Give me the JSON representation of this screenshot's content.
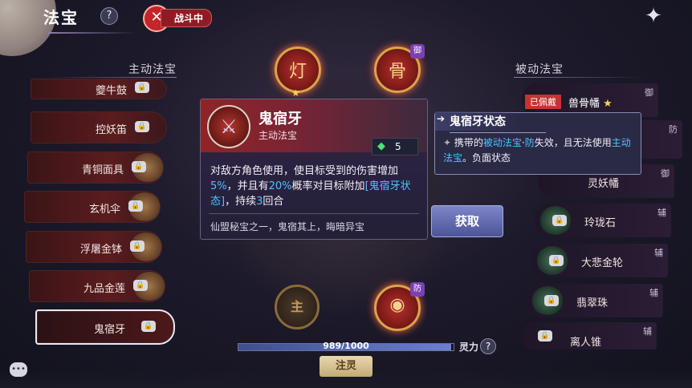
{
  "header": {
    "title": "法宝",
    "help_icon": "?",
    "battle_status": "战斗中",
    "battle_icon": "crossed-swords-icon",
    "close_icon": "shuriken-close-icon"
  },
  "left_panel": {
    "heading": "主动法宝",
    "items": [
      {
        "label": "夔牛鼓",
        "locked": true
      },
      {
        "label": "控妖笛",
        "locked": true
      },
      {
        "label": "青铜面具",
        "locked": true
      },
      {
        "label": "玄机伞",
        "locked": true
      },
      {
        "label": "浮屠金钵",
        "locked": true
      },
      {
        "label": "九品金莲",
        "locked": true
      },
      {
        "label": "鬼宿牙",
        "locked": true,
        "selected": true
      }
    ]
  },
  "right_panel": {
    "heading": "被动法宝",
    "equipped_badge": "已佩戴",
    "items": [
      {
        "label": "兽骨幡",
        "tag": "御",
        "equipped": true,
        "star": "★"
      },
      {
        "label": "",
        "tag": "防"
      },
      {
        "label": "灵妖幡",
        "tag": "御",
        "locked": true
      },
      {
        "label": "玲珑石",
        "tag": "辅",
        "locked": true
      },
      {
        "label": "大悲金轮",
        "tag": "辅",
        "locked": true
      },
      {
        "label": "翡翠珠",
        "tag": "辅",
        "locked": true
      },
      {
        "label": "离人锥",
        "tag": "辅",
        "locked": true
      }
    ]
  },
  "wheel": {
    "slots": [
      {
        "name": "lantern-slot",
        "icon": "lantern-icon",
        "glyph": "灯",
        "star": "★"
      },
      {
        "name": "skull-slot",
        "icon": "beast-skull-icon",
        "glyph": "骨",
        "badge": "御"
      },
      {
        "name": "eye-slot",
        "icon": "eye-pendant-icon",
        "glyph": "◉",
        "badge": "防"
      }
    ],
    "main_slot_label": "主"
  },
  "detail_card": {
    "name": "鬼宿牙",
    "type": "主动法宝",
    "icon": "fang-dagger-icon",
    "cost": "5",
    "desc_parts": [
      "对敌方角色使用，使目标受到的伤害增加",
      "5%",
      "，并且有",
      "20%",
      "概率对目标附加",
      "[鬼宿牙状态]",
      "，持续",
      "3",
      "回合"
    ],
    "flavor": "仙盟秘宝之一，鬼宿其上，晦暗异宝",
    "get_button": "获取"
  },
  "status_tooltip": {
    "title": "鬼宿牙状态",
    "bullet": "✦",
    "desc_parts": [
      "携带的",
      "被动法宝",
      "·",
      "防",
      "失效，且无法使用",
      "主动法宝",
      "。负面状态"
    ]
  },
  "footer": {
    "progress_text": "989/1000",
    "progress_value": 0.989,
    "spirit_label": "灵力",
    "help_icon": "?",
    "inject_button": "注灵",
    "chat_icon": "chat-bubble-icon"
  },
  "colors": {
    "accent_blue": "#4fc2ff",
    "lock_red": "#c83234",
    "gold": "#d9a54a"
  }
}
